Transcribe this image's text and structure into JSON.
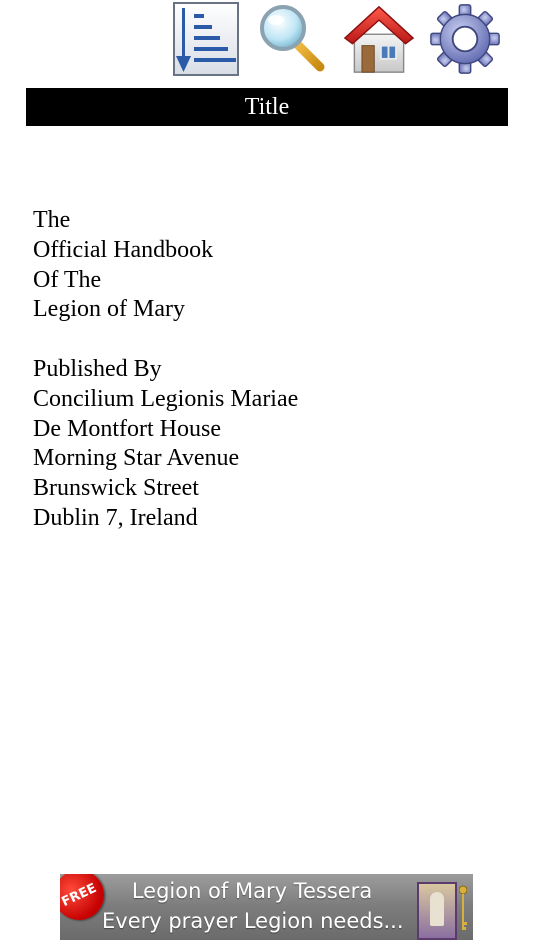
{
  "toolbar": {
    "buttons": [
      {
        "icon": "table-of-contents-icon"
      },
      {
        "icon": "search-icon"
      },
      {
        "icon": "home-icon"
      },
      {
        "icon": "settings-gear-icon"
      }
    ]
  },
  "header": {
    "title": "Title"
  },
  "content": {
    "title_lines": [
      "The",
      "Official Handbook",
      "Of The",
      "Legion of Mary"
    ],
    "publisher_lines": [
      "Published By",
      "Concilium Legionis Mariae",
      "De Montfort House",
      "Morning Star Avenue",
      "Brunswick Street",
      "Dublin 7, Ireland"
    ]
  },
  "ad": {
    "badge": "FREE",
    "line1": "Legion of Mary Tessera",
    "line2": "Every prayer Legion needs..."
  },
  "colors": {
    "titlebar_bg": "#000000",
    "titlebar_text": "#ffffff",
    "home_roof": "#e03030",
    "gear": "#7a84c8"
  }
}
